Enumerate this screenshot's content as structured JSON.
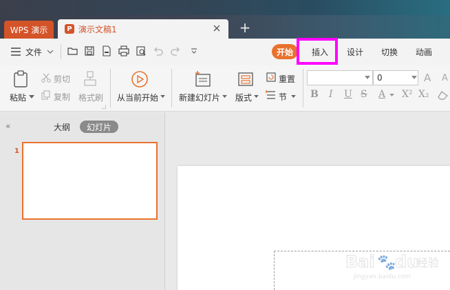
{
  "titlebar": {
    "app_tab": "WPS 演示",
    "doc_tab": "演示文稿1",
    "new_tab": "+"
  },
  "menu": {
    "file_label": "文件",
    "tabs": [
      {
        "label": "开始",
        "active": true
      },
      {
        "label": "插入",
        "highlighted": true
      },
      {
        "label": "设计"
      },
      {
        "label": "切换"
      },
      {
        "label": "动画"
      }
    ]
  },
  "ribbon": {
    "paste": "粘贴",
    "cut": "剪切",
    "copy": "复制",
    "format_painter": "格式刷",
    "from_current": "从当前开始",
    "new_slide": "新建幻灯片",
    "layout": "版式",
    "reset": "重置",
    "section": "节",
    "font_size": "0"
  },
  "left_panel": {
    "collapse": "«",
    "outline_tab": "大纲",
    "slides_tab": "幻灯片",
    "slide_number": "1"
  },
  "colors": {
    "accent": "#e9712c",
    "brand": "#d4542a",
    "highlight": "#ff00ff"
  }
}
